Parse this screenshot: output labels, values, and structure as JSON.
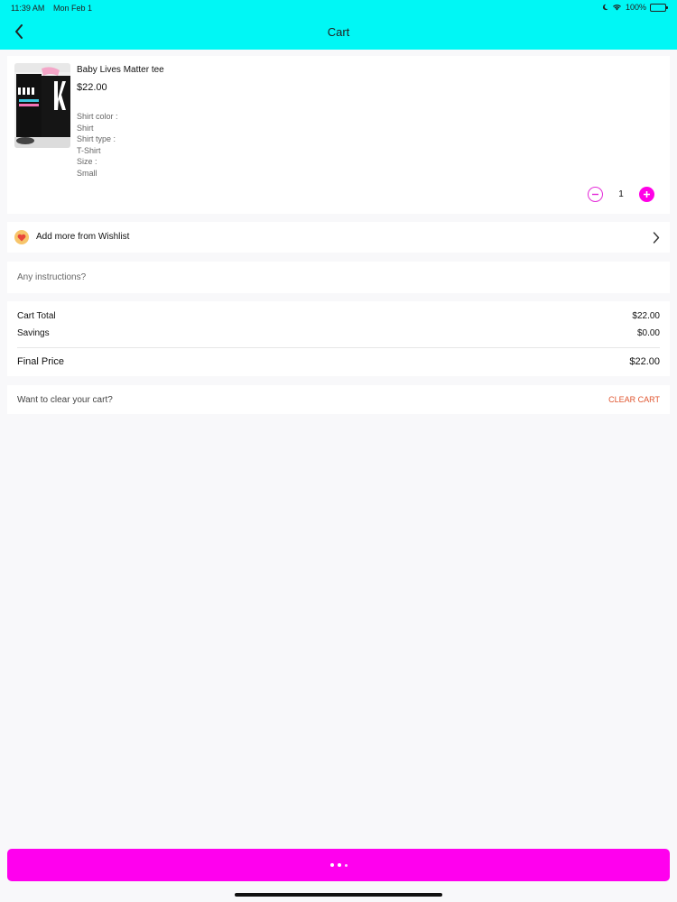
{
  "status": {
    "time": "11:39 AM",
    "date": "Mon Feb 1",
    "battery": "100%"
  },
  "header": {
    "title": "Cart"
  },
  "product": {
    "name": "Baby Lives Matter tee",
    "price": "$22.00",
    "attributes": [
      "Shirt color :",
      "Shirt",
      "Shirt type :",
      "T-Shirt",
      "Size :",
      "Small"
    ],
    "quantity": "1"
  },
  "wishlist": {
    "label": "Add more from Wishlist"
  },
  "instructions": {
    "placeholder": "Any instructions?"
  },
  "totals": {
    "cart_total_label": "Cart Total",
    "cart_total_value": "$22.00",
    "savings_label": "Savings",
    "savings_value": "$0.00",
    "final_label": "Final Price",
    "final_value": "$22.00"
  },
  "clear": {
    "prompt": "Want to clear your cart?",
    "button": "CLEAR CART"
  },
  "colors": {
    "header": "#00f7f5",
    "accent": "#ff00ee",
    "clear": "#e0552f"
  }
}
